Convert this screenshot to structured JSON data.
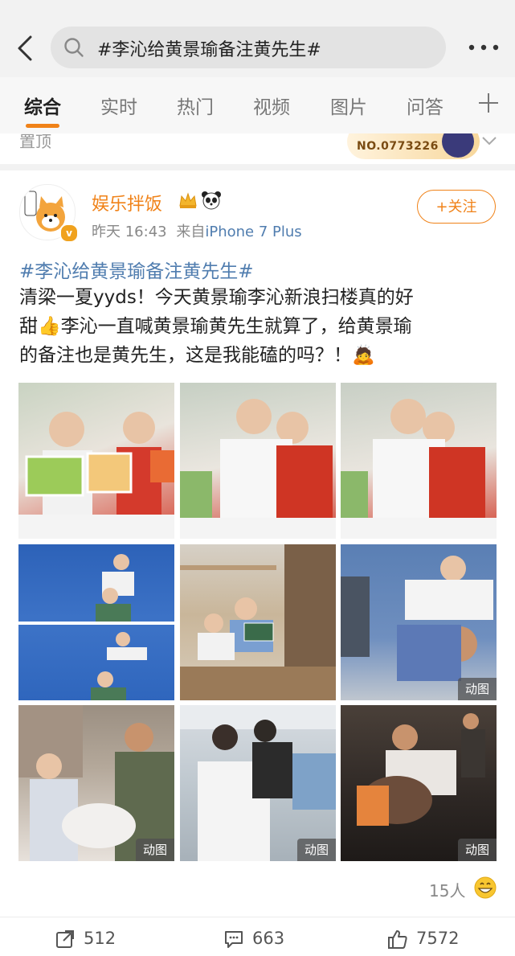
{
  "search": {
    "query": "#李沁给黄景瑜备注黄先生#"
  },
  "tabs": [
    {
      "label": "综合",
      "active": true
    },
    {
      "label": "实时",
      "active": false
    },
    {
      "label": "热门",
      "active": false
    },
    {
      "label": "视频",
      "active": false
    },
    {
      "label": "图片",
      "active": false
    },
    {
      "label": "问答",
      "active": false
    }
  ],
  "pinned": {
    "label": "置顶",
    "fan_badge": "NO.0773226"
  },
  "post": {
    "author": "娱乐拌饭",
    "time": "昨天 16:43",
    "source_prefix": "来自",
    "source": "iPhone 7 Plus",
    "follow_label": "+关注",
    "hashtag": "#李沁给黄景瑜备注黄先生#",
    "text_lines": [
      "清梁一夏yyds！今天黄景瑜李沁新浪扫楼真的好",
      "甜👍李沁一直喊黄景瑜黄先生就算了，给黄景瑜",
      "的备注也是黄先生，这是我能磕的吗？！🙇"
    ],
    "gif_label": "动图",
    "reactions": "15人",
    "repost_count": "512",
    "comment_count": "663",
    "like_count": "7572"
  },
  "colors": {
    "accent": "#f08218",
    "link": "#507daf"
  }
}
